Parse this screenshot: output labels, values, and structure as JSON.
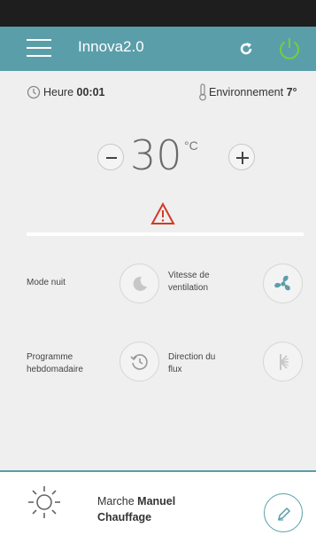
{
  "app": {
    "title": "Innova2.0",
    "accent_color": "#5a9eaa",
    "power_color": "#6cd23c",
    "alert_color": "#d13a26"
  },
  "header": {
    "menu_icon": "hamburger-menu-icon",
    "refresh_icon": "refresh-icon",
    "power_icon": "power-icon"
  },
  "info": {
    "time_label": "Heure",
    "time_value": "00:01",
    "environment_label": "Environnement",
    "environment_value": "7°"
  },
  "thermostat": {
    "temperature": "30",
    "unit": "°C",
    "decrease_icon": "minus-icon",
    "increase_icon": "plus-icon",
    "warning_icon": "warning-triangle-icon"
  },
  "controls": {
    "night_mode": {
      "label": "Mode nuit",
      "icon": "moon-icon"
    },
    "fan_speed": {
      "label": "Vitesse de\nventilation",
      "icon": "fan-icon"
    },
    "weekly_program": {
      "label": "Programme\nhebdomadaire",
      "icon": "weekly-clock-icon"
    },
    "airflow_direction": {
      "label": "Direction du\nflux",
      "icon": "airflow-direction-icon"
    }
  },
  "status": {
    "mode_prefix": "Marche",
    "mode_value": "Manuel",
    "function": "Chauffage",
    "mode_icon": "sun-icon",
    "edit_icon": "pencil-icon"
  }
}
